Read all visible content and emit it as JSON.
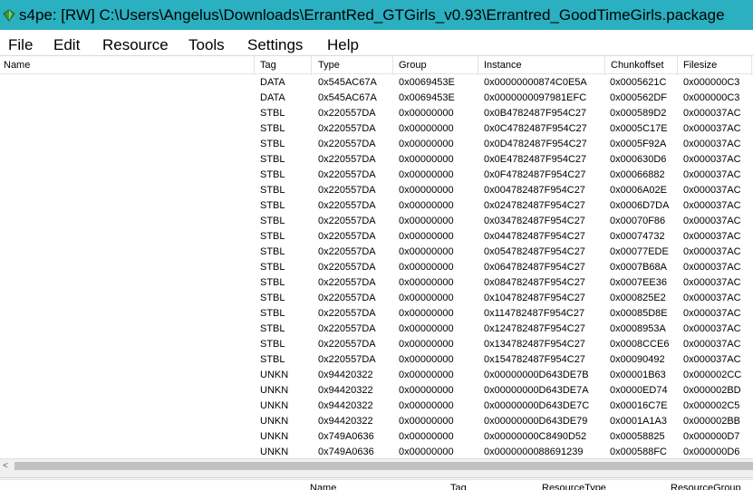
{
  "window": {
    "title": "s4pe: [RW] C:\\Users\\Angelus\\Downloads\\ErrantRed_GTGirls_v0.93\\Errantred_GoodTimeGirls.package",
    "icon": "s4pe-app-icon"
  },
  "menu": {
    "items": [
      "File",
      "Edit",
      "Resource",
      "Tools",
      "Settings",
      "Help"
    ]
  },
  "table": {
    "columns": [
      "Name",
      "Tag",
      "Type",
      "Group",
      "Instance",
      "Chunkoffset",
      "Filesize"
    ],
    "rows": [
      [
        "",
        "DATA",
        "0x545AC67A",
        "0x0069453E",
        "0x00000000874C0E5A",
        "0x0005621C",
        "0x000000C3"
      ],
      [
        "",
        "DATA",
        "0x545AC67A",
        "0x0069453E",
        "0x0000000097981EFC",
        "0x000562DF",
        "0x000000C3"
      ],
      [
        "",
        "STBL",
        "0x220557DA",
        "0x00000000",
        "0x0B4782487F954C27",
        "0x000589D2",
        "0x000037AC"
      ],
      [
        "",
        "STBL",
        "0x220557DA",
        "0x00000000",
        "0x0C4782487F954C27",
        "0x0005C17E",
        "0x000037AC"
      ],
      [
        "",
        "STBL",
        "0x220557DA",
        "0x00000000",
        "0x0D4782487F954C27",
        "0x0005F92A",
        "0x000037AC"
      ],
      [
        "",
        "STBL",
        "0x220557DA",
        "0x00000000",
        "0x0E4782487F954C27",
        "0x000630D6",
        "0x000037AC"
      ],
      [
        "",
        "STBL",
        "0x220557DA",
        "0x00000000",
        "0x0F4782487F954C27",
        "0x00066882",
        "0x000037AC"
      ],
      [
        "",
        "STBL",
        "0x220557DA",
        "0x00000000",
        "0x004782487F954C27",
        "0x0006A02E",
        "0x000037AC"
      ],
      [
        "",
        "STBL",
        "0x220557DA",
        "0x00000000",
        "0x024782487F954C27",
        "0x0006D7DA",
        "0x000037AC"
      ],
      [
        "",
        "STBL",
        "0x220557DA",
        "0x00000000",
        "0x034782487F954C27",
        "0x00070F86",
        "0x000037AC"
      ],
      [
        "",
        "STBL",
        "0x220557DA",
        "0x00000000",
        "0x044782487F954C27",
        "0x00074732",
        "0x000037AC"
      ],
      [
        "",
        "STBL",
        "0x220557DA",
        "0x00000000",
        "0x054782487F954C27",
        "0x00077EDE",
        "0x000037AC"
      ],
      [
        "",
        "STBL",
        "0x220557DA",
        "0x00000000",
        "0x064782487F954C27",
        "0x0007B68A",
        "0x000037AC"
      ],
      [
        "",
        "STBL",
        "0x220557DA",
        "0x00000000",
        "0x084782487F954C27",
        "0x0007EE36",
        "0x000037AC"
      ],
      [
        "",
        "STBL",
        "0x220557DA",
        "0x00000000",
        "0x104782487F954C27",
        "0x000825E2",
        "0x000037AC"
      ],
      [
        "",
        "STBL",
        "0x220557DA",
        "0x00000000",
        "0x114782487F954C27",
        "0x00085D8E",
        "0x000037AC"
      ],
      [
        "",
        "STBL",
        "0x220557DA",
        "0x00000000",
        "0x124782487F954C27",
        "0x0008953A",
        "0x000037AC"
      ],
      [
        "",
        "STBL",
        "0x220557DA",
        "0x00000000",
        "0x134782487F954C27",
        "0x0008CCE6",
        "0x000037AC"
      ],
      [
        "",
        "STBL",
        "0x220557DA",
        "0x00000000",
        "0x154782487F954C27",
        "0x00090492",
        "0x000037AC"
      ],
      [
        "",
        "UNKN",
        "0x94420322",
        "0x00000000",
        "0x00000000D643DE7B",
        "0x00001B63",
        "0x000002CC"
      ],
      [
        "",
        "UNKN",
        "0x94420322",
        "0x00000000",
        "0x00000000D643DE7A",
        "0x0000ED74",
        "0x000002BD"
      ],
      [
        "",
        "UNKN",
        "0x94420322",
        "0x00000000",
        "0x00000000D643DE7C",
        "0x00016C7E",
        "0x000002C5"
      ],
      [
        "",
        "UNKN",
        "0x94420322",
        "0x00000000",
        "0x00000000D643DE79",
        "0x0001A1A3",
        "0x000002BB"
      ],
      [
        "",
        "UNKN",
        "0x749A0636",
        "0x00000000",
        "0x00000000C8490D52",
        "0x00058825",
        "0x000000D7"
      ],
      [
        "",
        "UNKN",
        "0x749A0636",
        "0x00000000",
        "0x0000000088691239",
        "0x000588FC",
        "0x000000D6"
      ]
    ]
  },
  "scrollbar": {
    "left_arrow_icon": "chevron-left-icon",
    "left_arrow_glyph": "<"
  },
  "detail_header": {
    "columns": [
      "Name",
      "Tag",
      "ResourceType",
      "ResourceGroup"
    ]
  },
  "colors": {
    "titlebar": "#2ab0c0"
  }
}
